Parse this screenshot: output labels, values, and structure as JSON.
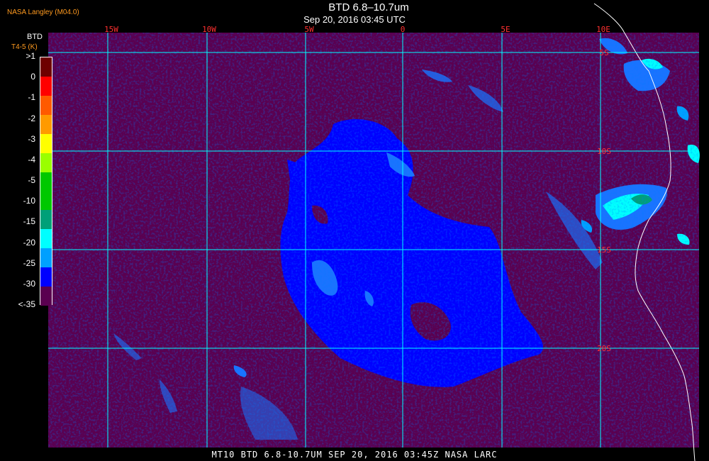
{
  "header": {
    "credit": "NASA Langley (M04.0)",
    "title": "BTD 6.8–10.7um",
    "subtitle": "Sep 20, 2016 03:45 UTC"
  },
  "legend": {
    "title": "BTD",
    "units": "T4-5 (K)",
    "labels": [
      ">1",
      "0",
      "-1",
      "-2",
      "-3",
      "-4",
      "-5",
      "-10",
      "-15",
      "-20",
      "-25",
      "-30",
      "<-35"
    ],
    "colors": [
      "#6e0000",
      "#ff0000",
      "#ff5a00",
      "#ff9a00",
      "#ffff00",
      "#9aff00",
      "#00c800",
      "#00c800",
      "#00a078",
      "#00ffff",
      "#00a0ff",
      "#0000ff",
      "#5a0050"
    ]
  },
  "map": {
    "ocean_color": "#5a0050",
    "grid_color": "#00ffff",
    "label_color": "#ff3030",
    "lon_labels": [
      "15W",
      "10W",
      "5W",
      "0",
      "5E",
      "10E"
    ],
    "lat_labels": [
      "5S",
      "10S",
      "15S",
      "20S"
    ]
  },
  "footer": {
    "text": "MT10  BTD 6.8-10.7UM   SEP 20, 2016 03:45Z   NASA LARC"
  }
}
